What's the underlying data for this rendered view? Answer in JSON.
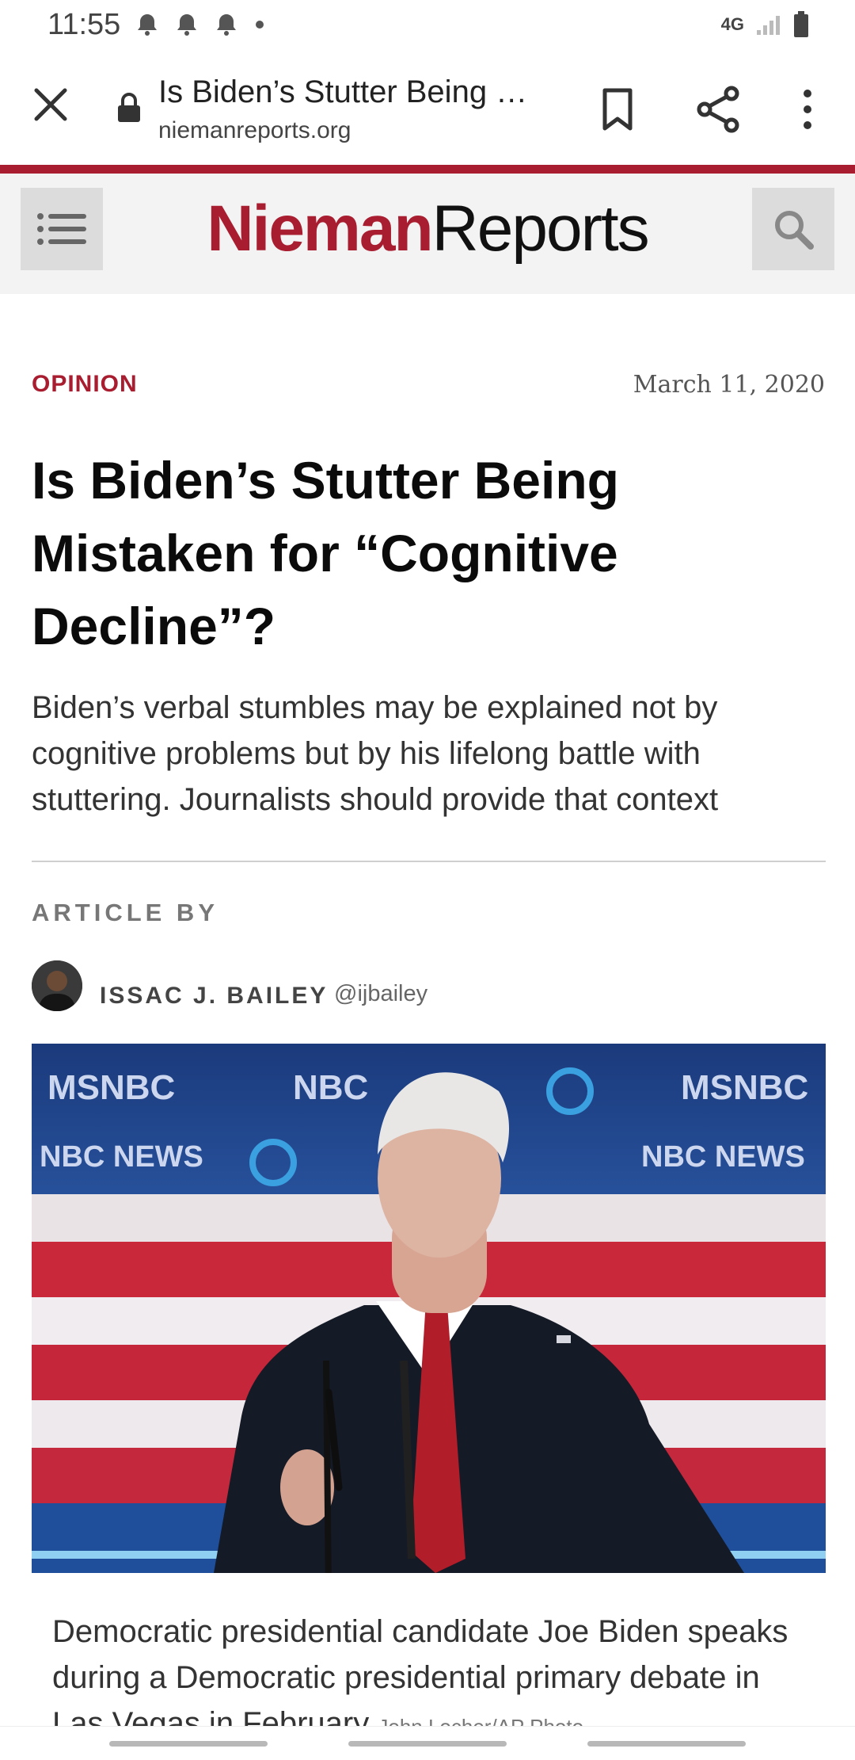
{
  "status_bar": {
    "time": "11:55",
    "icons": [
      "bell-icon",
      "bell-icon",
      "bell-icon",
      "dot-icon"
    ],
    "network": "4G",
    "right_icons": [
      "signal-icon",
      "battery-icon"
    ]
  },
  "browser": {
    "page_title": "Is Biden’s Stutter Being …",
    "domain": "niemanreports.org",
    "icons": [
      "close-icon",
      "lock-icon",
      "bookmark-icon",
      "share-icon",
      "more-icon"
    ]
  },
  "site": {
    "logo_part1": "Nieman",
    "logo_part2": "Reports",
    "accent_color": "#a81d2f",
    "icons": [
      "menu-icon",
      "search-icon"
    ]
  },
  "article": {
    "kicker": "OPINION",
    "date": "March 11, 2020",
    "headline": "Is Biden’s Stutter Being Mistaken for “Cognitive Decline”?",
    "dek": "Biden’s verbal stumbles may be explained not by cognitive problems but by his lifelong battle with stuttering. Journalists should provide that context",
    "byline_label": "ARTICLE BY",
    "author": "ISSAC J. BAILEY",
    "handle": "@ijbailey",
    "photo_bg_text": [
      "MSNBC",
      "NBC",
      "MSNBC",
      "NBC NEWS",
      "NBC NEWS"
    ],
    "caption": "Democratic presidential candidate Joe Biden speaks during a Democratic presidential primary debate in Las Vegas in February",
    "credit": "John Locher/AP Photo"
  }
}
